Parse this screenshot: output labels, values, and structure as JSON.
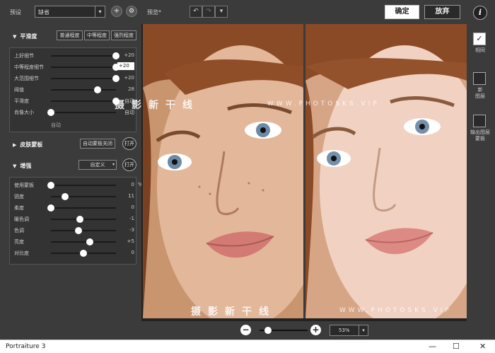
{
  "topbar": {
    "preset_label": "预设",
    "preset_value": "缺省",
    "add_symbol": "+",
    "settings_symbol": "⚙",
    "preview_label": "预览*",
    "undo_symbol": "↶",
    "redo_symbol": "↷",
    "history_dropdown_symbol": "▾",
    "ok_label": "确定",
    "cancel_label": "放弃",
    "info_symbol": "i"
  },
  "smoothing": {
    "title": "平滑度",
    "presets": [
      "普通程度",
      "中等程度",
      "强烈程度"
    ],
    "sliders": [
      {
        "label": "上好细节",
        "value": "+20",
        "position": 1.0
      },
      {
        "label": "中等程度细节",
        "value": "+20",
        "position": 1.0,
        "highlight": true
      },
      {
        "label": "大范围细节",
        "value": "+20",
        "position": 1.0
      },
      {
        "label": "阈值",
        "value": "28",
        "position": 0.72
      },
      {
        "label": "平滑度",
        "value": "自动",
        "position": 1.0
      },
      {
        "label": "肖像大小",
        "value": "自动",
        "position": 0.0
      }
    ],
    "portrait_sub_label": "自动"
  },
  "skin_mask": {
    "title": "皮肤蒙板",
    "mode_label": "自动蒙板关闭",
    "open_label": "打开"
  },
  "enhance": {
    "title": "增强",
    "mode_label": "自定义",
    "open_label": "打开",
    "sliders": [
      {
        "label": "使用蒙板",
        "value": "0",
        "unit": "%",
        "position": 0.0
      },
      {
        "label": "锐度",
        "value": "11",
        "position": 0.22
      },
      {
        "label": "柔度",
        "value": "0",
        "position": 0.0
      },
      {
        "label": "暖色调",
        "value": "-1",
        "position": 0.45
      },
      {
        "label": "色调",
        "value": "-3",
        "position": 0.42
      },
      {
        "label": "亮度",
        "value": "+5",
        "position": 0.6
      },
      {
        "label": "对比度",
        "value": "0",
        "position": 0.5
      }
    ]
  },
  "watermark": {
    "text": "摄影新干线",
    "url": "WWW.PHOTOSKS.VIP"
  },
  "right_bar": {
    "check_symbol": "✓",
    "items": [
      "相同",
      "新\n图层",
      "输出图层\n蒙板"
    ]
  },
  "zoom": {
    "minus_symbol": "−",
    "plus_symbol": "+",
    "level": "53%",
    "dropdown_symbol": "▾",
    "position": 0.1
  },
  "window": {
    "title": "Portraiture 3",
    "minimize": "—",
    "maximize": "☐",
    "close": "✕"
  }
}
